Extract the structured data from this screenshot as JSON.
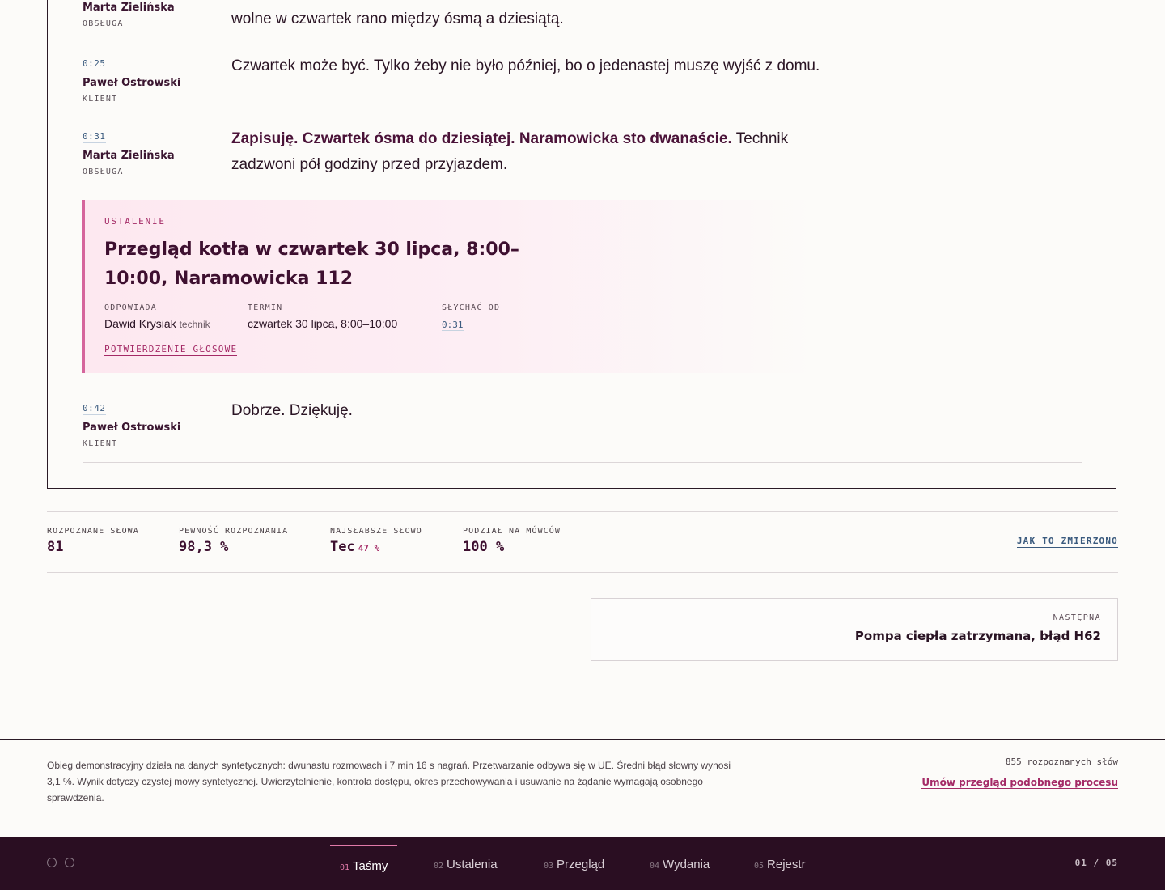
{
  "transcript": {
    "utterances": [
      {
        "speaker": "Marta Zielińska",
        "role": "OBSŁUGA",
        "text": "wolne w czwartek rano między ósmą a dziesiątą."
      },
      {
        "timestamp": "0:25",
        "speaker": "Paweł Ostrowski",
        "role": "KLIENT",
        "text": "Czwartek może być. Tylko żeby nie było później, bo o jedenastej muszę wyjść z domu."
      },
      {
        "timestamp": "0:31",
        "speaker": "Marta Zielińska",
        "role": "OBSŁUGA",
        "text_bold": "Zapisuję. Czwartek ósma do dziesiątej. Naramowicka sto dwanaście.",
        "text": "Technik zadzwoni pół godziny przed przyjazdem."
      },
      {
        "timestamp": "0:42",
        "speaker": "Paweł Ostrowski",
        "role": "KLIENT",
        "text": "Dobrze. Dziękuję."
      }
    ],
    "finding": {
      "tag": "USTALENIE",
      "title": "Przegląd kotła w czwartek 30 lipca, 8:00–10:00, Naramowicka 112",
      "owner_label": "ODPOWIADA",
      "owner_name": "Dawid Krysiak",
      "owner_role": "technik",
      "term_label": "TERMIN",
      "term_value": "czwartek 30 lipca, 8:00–10:00",
      "heard_label": "SŁYCHAĆ OD",
      "heard_value": "0:31",
      "link": "POTWIERDZENIE GŁOSOWE"
    }
  },
  "stats": {
    "items": [
      {
        "label": "ROZPOZNANE SŁOWA",
        "value": "81"
      },
      {
        "label": "PEWNOŚĆ ROZPOZNANIA",
        "value": "98,3 %"
      },
      {
        "label": "NAJSŁABSZE SŁOWO",
        "value": "Tec",
        "extra": "47 %"
      },
      {
        "label": "PODZIAŁ NA MÓWCÓW",
        "value": "100 %"
      }
    ],
    "how_link": "JAK TO ZMIERZONO"
  },
  "next": {
    "label": "NASTĘPNA",
    "title": "Pompa ciepła zatrzymana, błąd H62"
  },
  "footer": {
    "note": "Obieg demonstracyjny działa na danych syntetycznych: dwunastu rozmowach i 7 min 16 s nagrań. Przetwarzanie odbywa się w UE. Średni błąd słowny wynosi 3,1 %. Wynik dotyczy czystej mowy syntetycznej. Uwierzytelnienie, kontrola dostępu, okres przechowywania i usuwanie na żądanie wymagają osobnego sprawdzenia.",
    "words": "855 rozpoznanych słów",
    "cta": "Umów przegląd podobnego procesu"
  },
  "nav": {
    "items": [
      {
        "num": "01",
        "label": "Taśmy"
      },
      {
        "num": "02",
        "label": "Ustalenia"
      },
      {
        "num": "03",
        "label": "Przegląd"
      },
      {
        "num": "04",
        "label": "Wydania"
      },
      {
        "num": "05",
        "label": "Rejestr"
      }
    ],
    "active_index": 0,
    "pager": "01 / 05"
  },
  "colors": {
    "accent": "#a42a66",
    "accent_light": "#e07aa9",
    "bar_bg": "#2a0e22",
    "timestamp": "#3a5a7e"
  }
}
